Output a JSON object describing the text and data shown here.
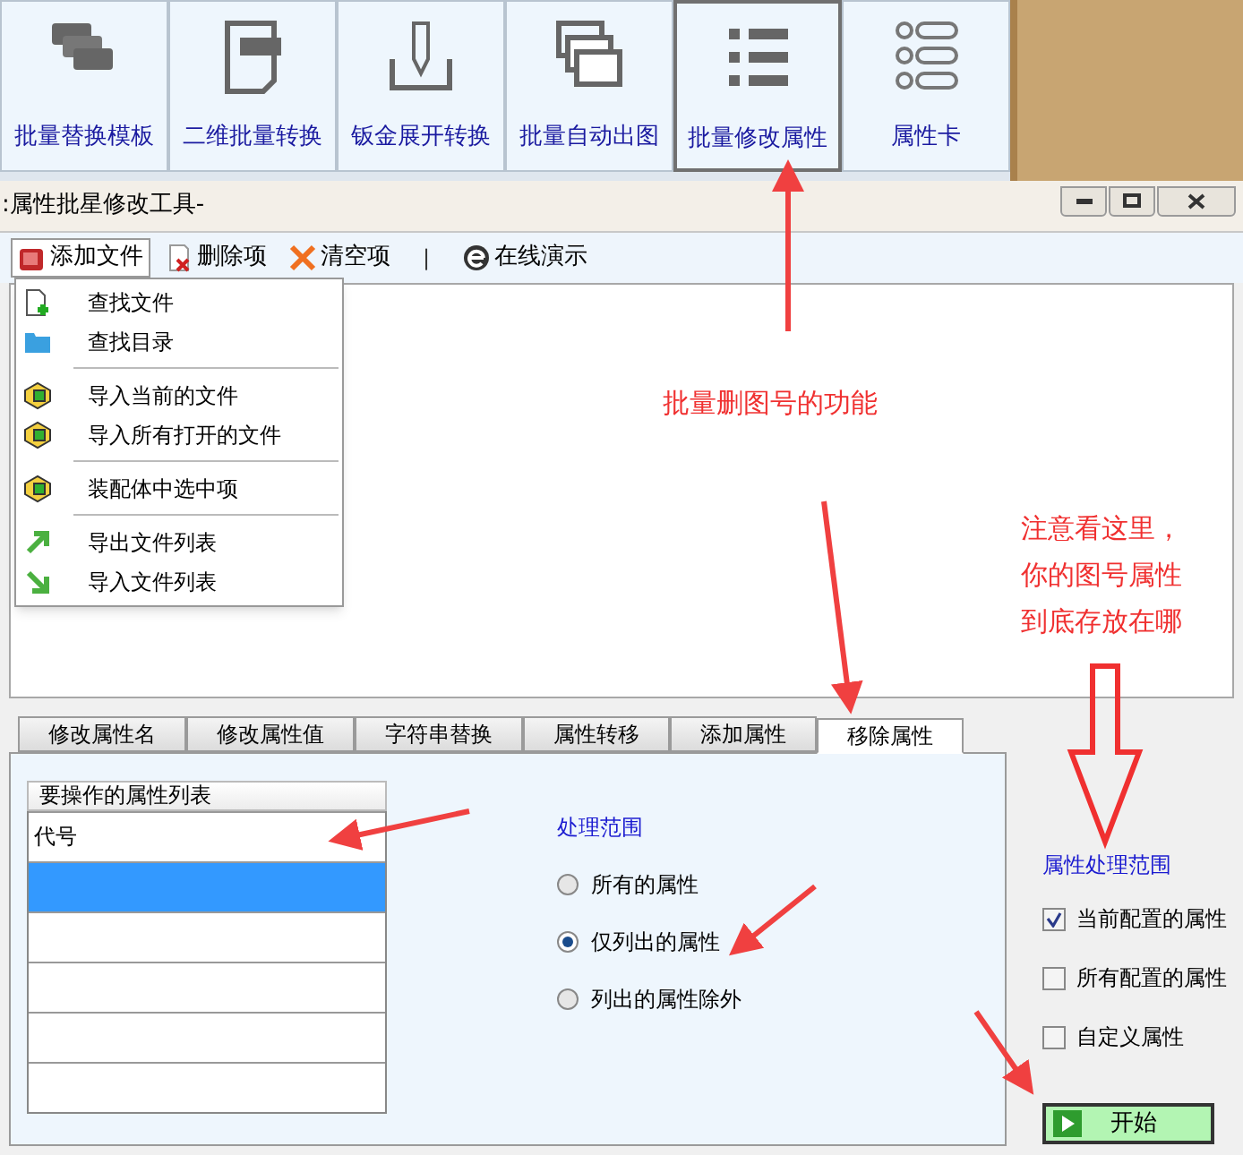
{
  "ribbon": [
    {
      "label": "批量替换模板",
      "selected": false
    },
    {
      "label": "二维批量转换",
      "selected": false
    },
    {
      "label": "钣金展开转换",
      "selected": false
    },
    {
      "label": "批量自动出图",
      "selected": false
    },
    {
      "label": "批量修改属性",
      "selected": true
    },
    {
      "label": "属性卡",
      "selected": false
    }
  ],
  "window": {
    "title": ":属性批星修改工具-"
  },
  "toolbar": [
    {
      "kind": "menu",
      "label": "添加文件",
      "pressed": true
    },
    {
      "kind": "delete",
      "label": "删除项",
      "pressed": false
    },
    {
      "kind": "clear",
      "label": "清空项",
      "pressed": false
    },
    {
      "kind": "separator",
      "label": "|"
    },
    {
      "kind": "web",
      "label": "在线演示",
      "pressed": false
    }
  ],
  "menu": [
    {
      "kind": "newfile",
      "label": "查找文件"
    },
    {
      "kind": "folder",
      "label": "查找目录"
    },
    {
      "kind": "separator"
    },
    {
      "kind": "part",
      "label": "导入当前的文件"
    },
    {
      "kind": "part",
      "label": "导入所有打开的文件"
    },
    {
      "kind": "separator"
    },
    {
      "kind": "part",
      "label": "装配体中选中项"
    },
    {
      "kind": "separator"
    },
    {
      "kind": "export",
      "label": "导出文件列表"
    },
    {
      "kind": "import",
      "label": "导入文件列表"
    }
  ],
  "tabs": [
    {
      "label": "修改属性名",
      "selected": false
    },
    {
      "label": "修改属性值",
      "selected": false
    },
    {
      "label": "字符串替换",
      "selected": false
    },
    {
      "label": "属性转移",
      "selected": false
    },
    {
      "label": "添加属性",
      "selected": false
    },
    {
      "label": "移除属性",
      "selected": true
    }
  ],
  "property_list": {
    "header": "要操作的属性列表",
    "rows": [
      {
        "cell": "代号",
        "selected": false
      },
      {
        "selected": true
      },
      {
        "selected": false
      },
      {
        "selected": false
      },
      {
        "selected": false
      },
      {
        "selected": false
      }
    ]
  },
  "scope": {
    "title": "处理范围",
    "options": [
      {
        "label": "所有的属性",
        "selected": false
      },
      {
        "label": "仅列出的属性",
        "selected": true
      },
      {
        "label": "列出的属性除外",
        "selected": false
      }
    ]
  },
  "property_scope": {
    "title": "属性处理范围",
    "options": [
      {
        "label": "当前配置的属性",
        "checked": true
      },
      {
        "label": "所有配置的属性",
        "checked": false
      },
      {
        "label": "自定义属性",
        "checked": false
      }
    ]
  },
  "start_button": {
    "label": "开始"
  },
  "annotations": [
    {
      "kind": "single",
      "lines": [
        "批量删图号的功能"
      ]
    },
    {
      "kind": "stack",
      "lines": [
        "注意看这里，",
        "你的图号属性",
        "到底存放在哪"
      ]
    }
  ]
}
